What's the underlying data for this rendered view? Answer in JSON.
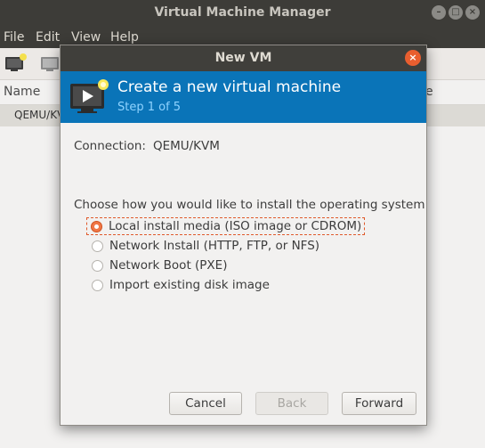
{
  "main_window": {
    "title": "Virtual Machine Manager",
    "menu": [
      "File",
      "Edit",
      "View",
      "Help"
    ],
    "list_header_name": "Name",
    "list_header_partial": "e",
    "row_label": "QEMU/KVM"
  },
  "dialog": {
    "title": "New VM",
    "banner_title": "Create a new virtual machine",
    "banner_step": "Step 1 of 5",
    "connection_label": "Connection:",
    "connection_value": "QEMU/KVM",
    "choose_label": "Choose how you would like to install the operating system",
    "options": [
      {
        "label": "Local install media (ISO image or CDROM)",
        "selected": true
      },
      {
        "label": "Network Install (HTTP, FTP, or NFS)",
        "selected": false
      },
      {
        "label": "Network Boot (PXE)",
        "selected": false
      },
      {
        "label": "Import existing disk image",
        "selected": false
      }
    ],
    "buttons": {
      "cancel": "Cancel",
      "back": "Back",
      "forward": "Forward"
    }
  },
  "colors": {
    "banner": "#0a74b8",
    "step_text": "#8fd3ff",
    "radio_selected": "#f07746",
    "close_button": "#e85e2f"
  }
}
